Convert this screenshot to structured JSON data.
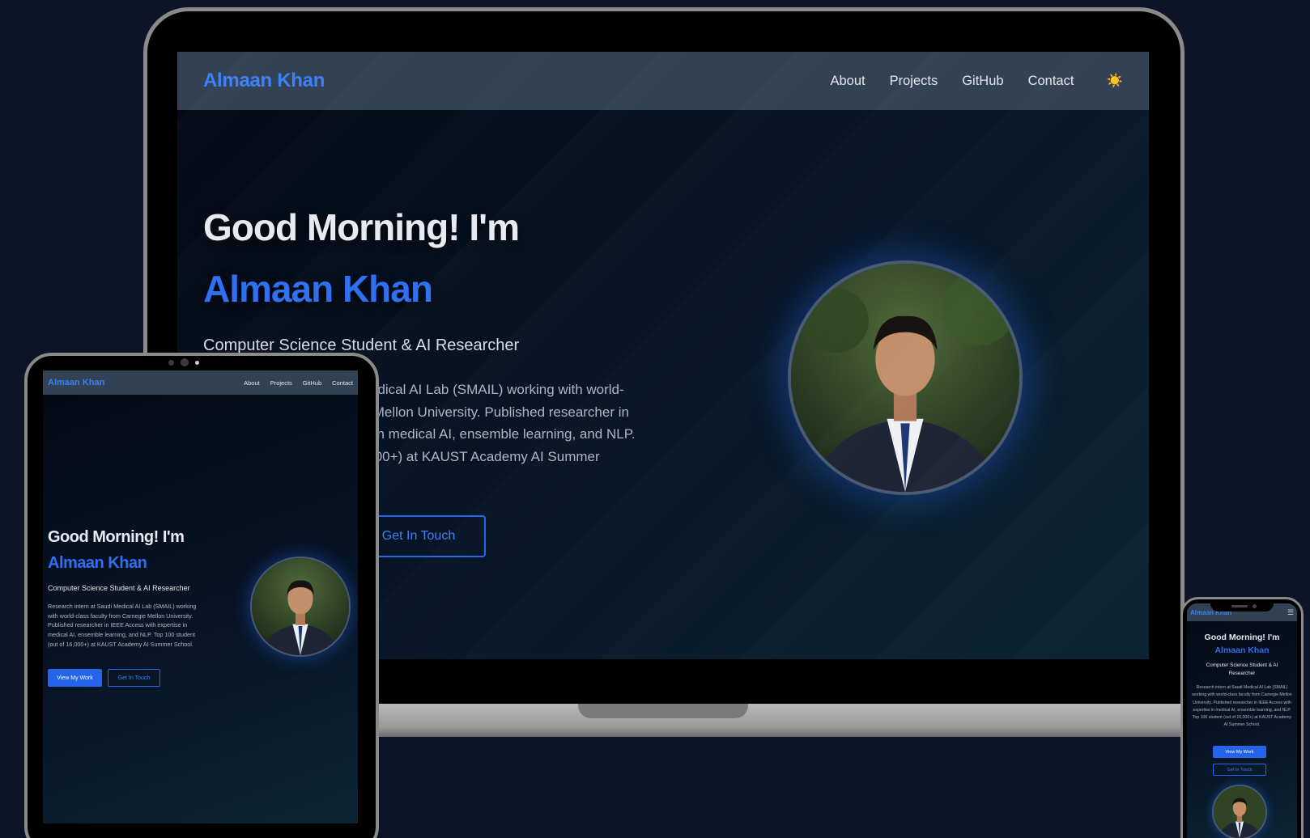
{
  "site": {
    "logo": "Almaan Khan",
    "nav": [
      "About",
      "Projects",
      "GitHub",
      "Contact"
    ],
    "theme_toggle_icon": "☀️",
    "greeting": "Good Morning! I'm",
    "name": "Almaan Khan",
    "role": "Computer Science Student & AI Researcher",
    "bio": "Research intern at Saudi Medical AI Lab (SMAIL) working with world-class faculty from Carnegie Mellon University. Published researcher in IEEE Access with expertise in medical AI, ensemble learning, and NLP. Top 100 student (out of 16,000+) at KAUST Academy AI Summer School.",
    "primary_button": "View My Work",
    "secondary_button": "Get In Touch"
  },
  "phone": {
    "menu_icon": "☰"
  },
  "colors": {
    "background": "#0e1428",
    "nav_bg": "#334155",
    "accent": "#2563eb",
    "logo": "#3b82f6"
  }
}
